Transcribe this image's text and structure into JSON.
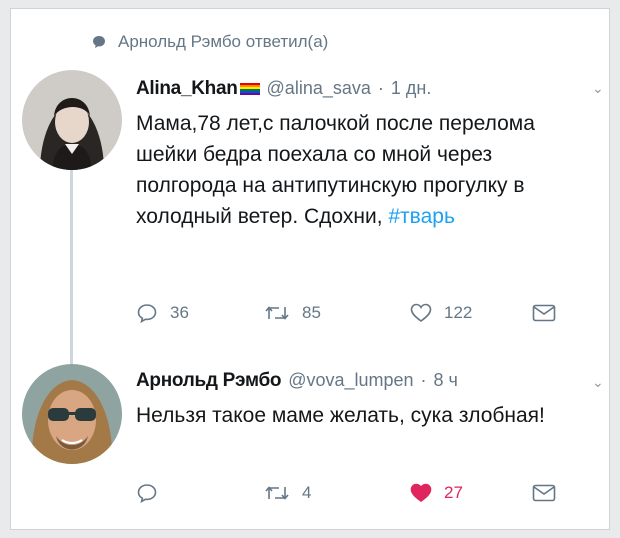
{
  "context": {
    "label": "Арнольд Рэмбо ответил(а)",
    "icon": "reply-bubble-icon"
  },
  "tweets": [
    {
      "name": "Alina_Khan",
      "badge_icon": "rainbow-flag-icon",
      "handle": "@alina_sava",
      "separator": "·",
      "time": "1 дн.",
      "text": "Мама,78 лет,с палочкой после перелома шейки бедра поехала со мной через полгорода на антипутинскую прогулку в холодный ветер. Сдохни, ",
      "hashtag": "#тварь",
      "actions": {
        "replies": "36",
        "retweets": "85",
        "likes": "122",
        "liked": false
      }
    },
    {
      "name": "Арнольд Рэмбо",
      "handle": "@vova_lumpen",
      "separator": "·",
      "time": "8 ч",
      "text": "Нельзя такое маме желать, сука злобная!",
      "actions": {
        "replies": "",
        "retweets": "4",
        "likes": "27",
        "liked": true
      }
    }
  ],
  "colors": {
    "link": "#1da1f2",
    "muted": "#657786",
    "like_active": "#e0245e",
    "thread_line": "#ccd6dd"
  }
}
